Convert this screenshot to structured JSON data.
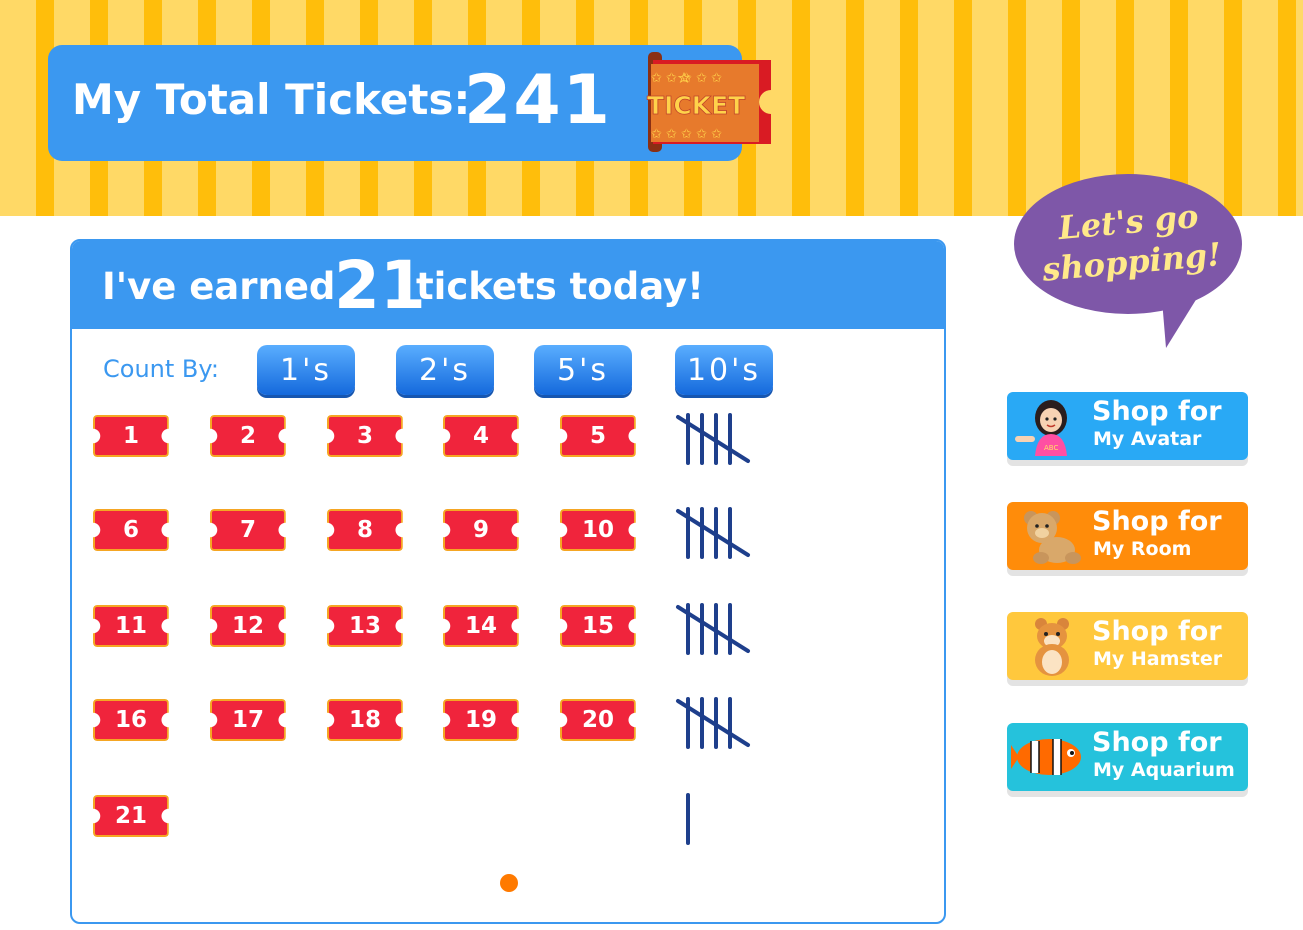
{
  "header": {
    "total_label": "My Total Tickets:",
    "total_value": "241",
    "ticket_icon_text": "TICKET"
  },
  "bubble": {
    "line1": "Let's go",
    "line2": "shopping!"
  },
  "panel": {
    "earned_prefix": "I've earned",
    "earned_count": "21",
    "earned_suffix": "tickets today!",
    "count_by_label": "Count By:",
    "count_buttons": [
      "1's",
      "2's",
      "5's",
      "10's"
    ],
    "tickets": [
      "1",
      "2",
      "3",
      "4",
      "5",
      "6",
      "7",
      "8",
      "9",
      "10",
      "11",
      "12",
      "13",
      "14",
      "15",
      "16",
      "17",
      "18",
      "19",
      "20",
      "21"
    ],
    "tally_groups": [
      5,
      5,
      5,
      5,
      1
    ],
    "page_indicator_count": 1
  },
  "shop": [
    {
      "line1": "Shop for",
      "line2": "My Avatar",
      "icon": "avatar-girl-icon"
    },
    {
      "line1": "Shop for",
      "line2": "My Room",
      "icon": "teddy-bear-icon"
    },
    {
      "line1": "Shop for",
      "line2": "My Hamster",
      "icon": "hamster-icon"
    },
    {
      "line1": "Shop for",
      "line2": "My Aquarium",
      "icon": "clownfish-icon"
    }
  ],
  "colors": {
    "primary_blue": "#3b98f0",
    "ticket_red": "#f0243c",
    "stripe_light": "#ffd966",
    "stripe_dark": "#ffbe0b",
    "bubble_purple": "#7e57a8",
    "dot_orange": "#ff7a00"
  }
}
